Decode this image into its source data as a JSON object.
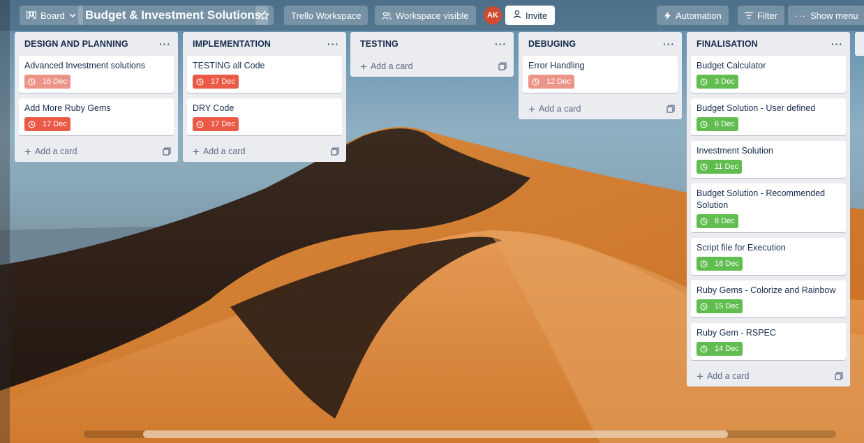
{
  "header": {
    "board_view": "Board",
    "board_title": "Budget & Investment Solutions",
    "workspace": "Trello Workspace",
    "visibility": "Workspace visible",
    "avatar_initials": "AK",
    "invite": "Invite",
    "automation": "Automation",
    "filter": "Filter",
    "show_menu": "Show menu"
  },
  "add_card_label": "Add a card",
  "lists": [
    {
      "title": "DESIGN AND PLANNING",
      "cards": [
        {
          "title": "Advanced Investment solutions",
          "due": "16 Dec",
          "status": "pink"
        },
        {
          "title": "Add More Ruby Gems",
          "due": "17 Dec",
          "status": "red"
        }
      ]
    },
    {
      "title": "IMPLEMENTATION",
      "cards": [
        {
          "title": "TESTING all Code",
          "due": "17 Dec",
          "status": "red"
        },
        {
          "title": "DRY Code",
          "due": "17 Dec",
          "status": "red"
        }
      ]
    },
    {
      "title": "TESTING",
      "cards": []
    },
    {
      "title": "DEBUGING",
      "cards": [
        {
          "title": "Error Handling",
          "due": "12 Dec",
          "status": "pink"
        }
      ]
    },
    {
      "title": "FINALISATION",
      "cards": [
        {
          "title": "Budget Calculator",
          "due": "3 Dec",
          "status": "green"
        },
        {
          "title": "Budget Solution - User defined",
          "due": "6 Dec",
          "status": "green"
        },
        {
          "title": "Investment Solution",
          "due": "11 Dec",
          "status": "green"
        },
        {
          "title": "Budget Solution - Recommended Solution",
          "due": "8 Dec",
          "status": "green"
        },
        {
          "title": "Script file for Execution",
          "due": "16 Dec",
          "status": "green"
        },
        {
          "title": "Ruby Gems - Colorize and Rainbow",
          "due": "15 Dec",
          "status": "green"
        },
        {
          "title": "Ruby Gem - RSPEC",
          "due": "14 Dec",
          "status": "green"
        }
      ]
    }
  ],
  "colors": {
    "due_overdue": "#eb5a46",
    "due_recent": "#ec9488",
    "due_complete": "#61bd4f",
    "list_bg": "#ebecf0",
    "avatar": "#d04b2f"
  }
}
